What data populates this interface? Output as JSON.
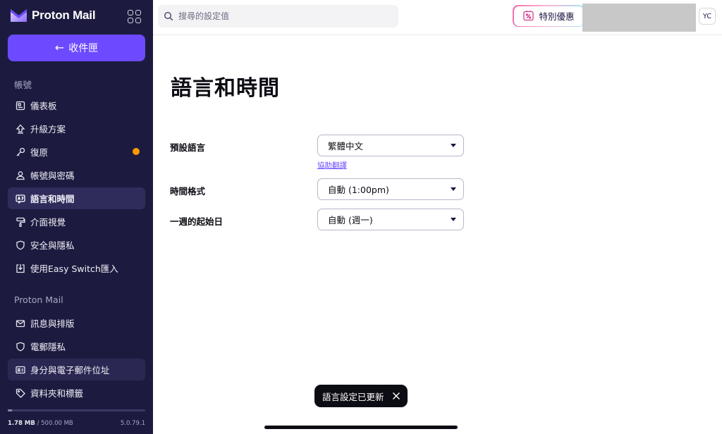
{
  "app": {
    "brand_name": "Proton Mail",
    "accent_color": "#6d4aff",
    "sidebar_color": "#1c1b3f"
  },
  "sidebar": {
    "back_label": "收件匣",
    "account_section_label": "帳號",
    "account_items": [
      {
        "label": "儀表板",
        "icon": "dashboard-icon"
      },
      {
        "label": "升級方案",
        "icon": "upgrade-icon"
      },
      {
        "label": "復原",
        "icon": "key-icon",
        "notification_dot": true
      },
      {
        "label": "帳號與密碼",
        "icon": "user-icon"
      },
      {
        "label": "語言和時間",
        "icon": "language-icon",
        "active": true
      },
      {
        "label": "介面視覺",
        "icon": "paint-roller-icon"
      },
      {
        "label": "安全與隱私",
        "icon": "shield-icon"
      },
      {
        "label": "使用Easy Switch匯入",
        "icon": "import-icon"
      }
    ],
    "mail_section_label": "Proton Mail",
    "mail_items": [
      {
        "label": "訊息與排版",
        "icon": "envelope-icon"
      },
      {
        "label": "電郵隱私",
        "icon": "shield-icon"
      },
      {
        "label": "身分與電子郵件位址",
        "icon": "id-card-icon",
        "hover": true
      },
      {
        "label": "資料夾和標籤",
        "icon": "tag-icon"
      }
    ],
    "storage_used": "1.78 MB",
    "storage_total": "/ 500.00 MB",
    "storage_fraction": 0.0036,
    "version": "5.0.79.1"
  },
  "topbar": {
    "search_placeholder": "搜尋的設定值",
    "promo_label": "特別優惠",
    "avatar_initials": "YC"
  },
  "main": {
    "title": "語言和時間",
    "fields": [
      {
        "label": "預設語言",
        "value": "繁體中文"
      },
      {
        "label": "時間格式",
        "value": "自動 (1:00pm)"
      },
      {
        "label": "一週的起始日",
        "value": "自動 (週一)"
      }
    ],
    "help_link": "協助翻譯"
  },
  "toast": {
    "message": "語言設定已更新"
  }
}
